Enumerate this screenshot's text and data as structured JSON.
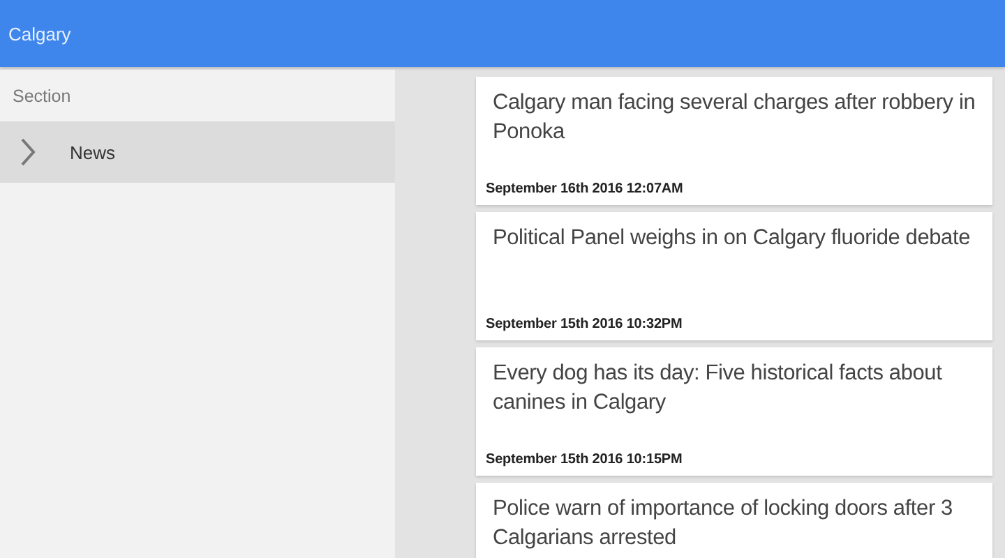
{
  "app_bar": {
    "title": "Calgary"
  },
  "sidebar": {
    "header": "Section",
    "items": [
      {
        "label": "News",
        "selected": true
      }
    ]
  },
  "articles": [
    {
      "title": "Calgary man facing several charges after robbery in Ponoka",
      "date": "September 16th 2016 12:07AM"
    },
    {
      "title": "Political Panel weighs in on Calgary fluoride debate",
      "date": "September 15th 2016 10:32PM"
    },
    {
      "title": "Every dog has its day: Five historical facts about canines in Calgary",
      "date": "September 15th 2016 10:15PM"
    },
    {
      "title": "Police warn of importance of locking doors after 3 Calgarians arrested"
    }
  ]
}
